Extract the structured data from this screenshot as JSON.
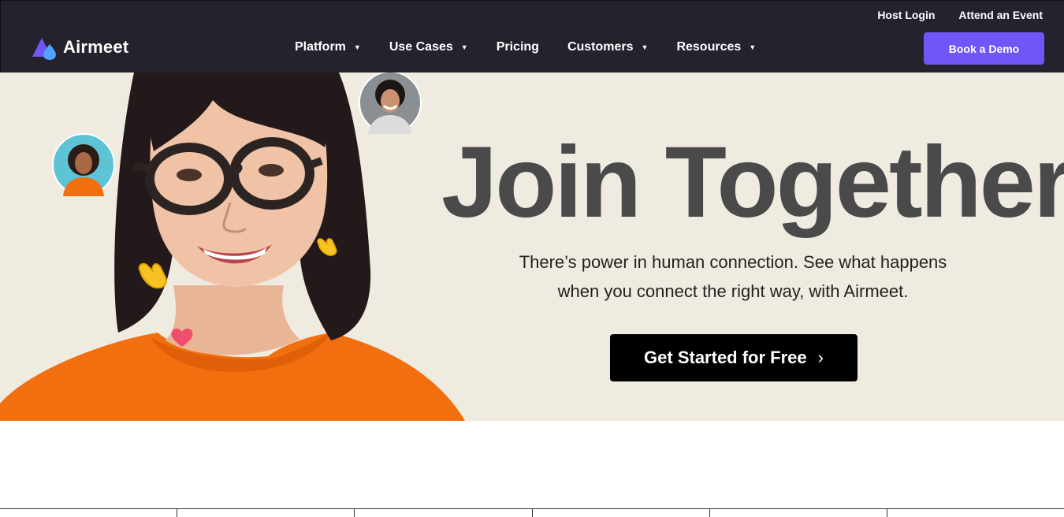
{
  "header": {
    "brand": "Airmeet",
    "utility_links": [
      "Host Login",
      "Attend an Event"
    ],
    "nav": [
      {
        "label": "Platform",
        "has_dropdown": true
      },
      {
        "label": "Use Cases",
        "has_dropdown": true
      },
      {
        "label": "Pricing",
        "has_dropdown": false
      },
      {
        "label": "Customers",
        "has_dropdown": true
      },
      {
        "label": "Resources",
        "has_dropdown": true
      }
    ],
    "demo_button": "Book a Demo",
    "colors": {
      "bar": "#25222e",
      "accent": "#7056f7"
    }
  },
  "hero": {
    "title": "Join Together",
    "subtitle_line1": "There’s power in human connection. See what happens",
    "subtitle_line2": "when you connect the right way, with Airmeet.",
    "cta_label": "Get Started for Free",
    "cta_icon": "chevron-right-icon",
    "background": "#f0ebe0",
    "image": "smiling-woman-with-glasses-orange-sweater",
    "reactions": [
      "waving-hand-emoji",
      "waving-hand-emoji",
      "heart-emoji"
    ],
    "avatars": [
      "avatar-woman-curly-hair",
      "avatar-man-curly-hair"
    ]
  }
}
